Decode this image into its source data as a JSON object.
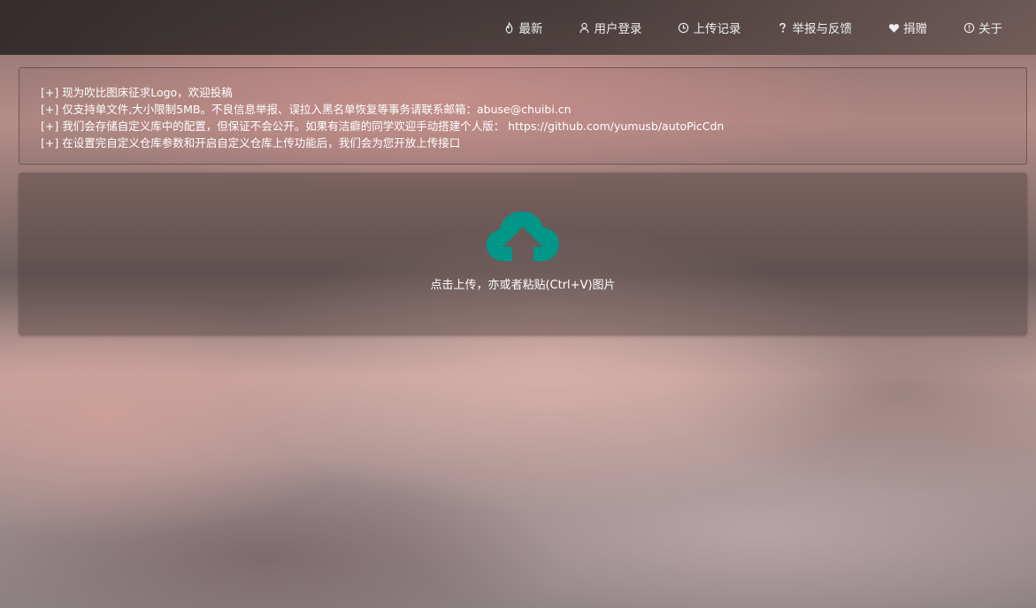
{
  "nav": {
    "items": [
      {
        "label": "最新",
        "icon": "flame-icon"
      },
      {
        "label": "用户登录",
        "icon": "user-icon"
      },
      {
        "label": "上传记录",
        "icon": "clock-icon"
      },
      {
        "label": "举报与反馈",
        "icon": "question-icon"
      },
      {
        "label": "捐赠",
        "icon": "heart-icon"
      },
      {
        "label": "关于",
        "icon": "info-icon"
      }
    ]
  },
  "notice": {
    "lines": [
      "[+] 现为吹比图床征求Logo，欢迎投稿",
      "[+] 仅支持单文件,大小限制5MB。不良信息举报、误拉入黑名单恢复等事务请联系邮箱：abuse@chuibi.cn",
      "[+] 我们会存储自定义库中的配置，但保证不会公开。如果有洁癖的同学欢迎手动搭建个人版： https://github.com/yumusb/autoPicCdn",
      "[+] 在设置完自定义仓库参数和开启自定义仓库上传功能后，我们会为您开放上传接口"
    ]
  },
  "upload": {
    "icon": "cloud-upload-icon",
    "icon_color": "#009688",
    "text": "点击上传，亦或者粘贴(Ctrl+V)图片"
  }
}
